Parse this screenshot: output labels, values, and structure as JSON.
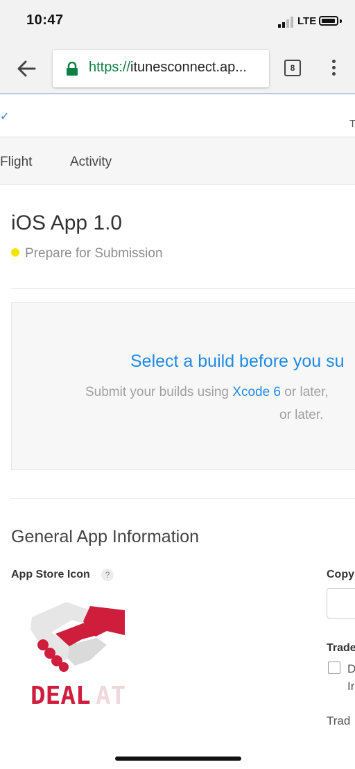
{
  "status_bar": {
    "time": "10:47",
    "network": "LTE"
  },
  "browser": {
    "url_scheme": "https://",
    "url_host": "itunesconnect.ap...",
    "tab_count": "8",
    "icons": [
      "back-arrow-icon",
      "lock-icon",
      "tabs-icon",
      "overflow-menu-icon"
    ],
    "secure_color": "#0b8043"
  },
  "page": {
    "top_right_fragment": "T",
    "tabs": [
      {
        "label": "Flight"
      },
      {
        "label": "Activity"
      }
    ],
    "version_title": "iOS App 1.0",
    "status": {
      "label": "Prepare for Submission",
      "color": "#f3e400"
    },
    "build": {
      "heading": "Select a build before you su",
      "sub_prefix": "Submit your builds using ",
      "sub_link": "Xcode 6",
      "sub_suffix": " or later,",
      "sub_line2": "or later.",
      "accent": "#1f8ae6"
    },
    "general": {
      "title": "General App Information",
      "app_store_icon_label": "App Store Icon",
      "help_glyph": "?",
      "copyright_label": "Copy",
      "trade_label": "Trade",
      "trade_option_line1": "D",
      "trade_option_line2": "Ir",
      "trade_bottom_label": "Trad",
      "icon_text_primary": "DEAL",
      "icon_text_secondary": "AT",
      "icon_brand_color": "#cf1d3c"
    }
  }
}
